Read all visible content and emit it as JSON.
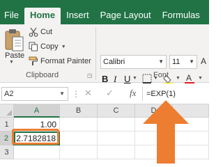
{
  "ribbon_tabs": [
    "File",
    "Home",
    "Insert",
    "Page Layout",
    "Formulas"
  ],
  "clipboard": {
    "paste_label": "Paste",
    "cut_label": "Cut",
    "copy_label": "Copy",
    "format_painter_label": "Format Painter",
    "group_label": "Clipboard"
  },
  "font": {
    "name": "Calibri",
    "size": "11",
    "group_label": "Font",
    "bold": "B",
    "italic": "I",
    "underline": "U"
  },
  "formula_bar": {
    "name_box": "A2",
    "fx": "fx",
    "formula": "=EXP(1)"
  },
  "sheet": {
    "columns": [
      "A",
      "B",
      "C",
      "D"
    ],
    "rows": [
      "1",
      "2",
      "3"
    ],
    "cells": {
      "A1": "1.00",
      "A2": "2.7182818"
    }
  },
  "colors": {
    "accent": "#217346",
    "highlight": "#ed7d31"
  }
}
